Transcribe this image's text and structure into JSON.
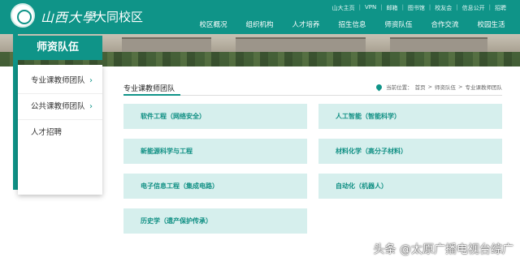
{
  "header": {
    "logo_calligraphy": "山西大學",
    "campus_name": "大同校区",
    "top_links": [
      "山大主页",
      "VPN",
      "邮箱",
      "图书馆",
      "校友会",
      "信息公开",
      "招聘"
    ],
    "main_nav": [
      "校区概况",
      "组织机构",
      "人才培养",
      "招生信息",
      "师资队伍",
      "合作交流",
      "校园生活"
    ]
  },
  "sidebar": {
    "title": "师资队伍",
    "items": [
      {
        "label": "专业课教师团队",
        "chevron": "›"
      },
      {
        "label": "公共课教师团队",
        "chevron": "›"
      },
      {
        "label": "人才招聘",
        "chevron": ""
      }
    ]
  },
  "content": {
    "title": "专业课教师团队",
    "breadcrumb": {
      "prefix": "当前位置：",
      "items": [
        "首页",
        "师资队伍",
        "专业课教师团队"
      ],
      "separator": ">"
    },
    "cards": [
      "软件工程（网络安全）",
      "人工智能（智能科学）",
      "新能源科学与工程",
      "材料化学（高分子材料）",
      "电子信息工程（集成电路）",
      "自动化（机器人）",
      "历史学（遗产保护传承）"
    ]
  },
  "watermark": "头条 @太原广播电视台综广",
  "colors": {
    "brand": "#0f9488",
    "card_bg": "#d6efed",
    "card_text": "#0f8f83"
  },
  "icons": {
    "location": "location-pin-icon",
    "seal": "university-seal-icon",
    "chevron": "chevron-right-icon"
  }
}
